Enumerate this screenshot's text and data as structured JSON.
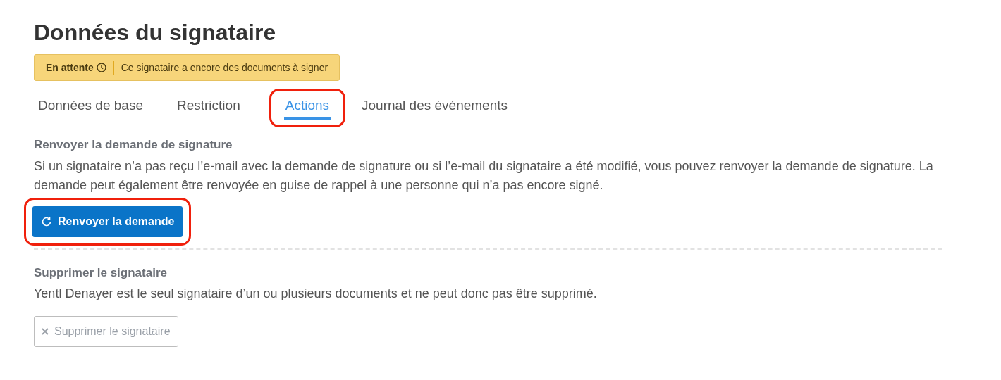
{
  "title": "Données du signataire",
  "status_badge": {
    "status": "En attente",
    "message": "Ce signataire a encore des documents à signer"
  },
  "tabs": [
    {
      "label": "Données de base",
      "selected": false,
      "highlighted": false
    },
    {
      "label": "Restriction",
      "selected": false,
      "highlighted": false
    },
    {
      "label": "Actions",
      "selected": true,
      "highlighted": true
    },
    {
      "label": "Journal des événements",
      "selected": false,
      "highlighted": false
    }
  ],
  "sections": [
    {
      "heading": "Renvoyer la demande de signature",
      "text": "Si un signataire n’a pas reçu l’e-mail avec la demande de signature ou si l’e-mail du signataire a été modifié, vous pouvez renvoyer la demande de signature. La demande peut également être renvoyée en guise de rappel à une personne qui n’a pas encore signé.",
      "button": {
        "kind": "resend",
        "label": "Renvoyer la demande",
        "disabled": false,
        "highlighted": true
      }
    },
    {
      "heading": "Supprimer le signataire",
      "text": "Yentl Denayer est le seul signataire d’un ou plusieurs documents et ne peut donc pas être supprimé.",
      "button": {
        "kind": "delete",
        "label": "Supprimer le signataire",
        "disabled": true,
        "highlighted": false
      }
    }
  ]
}
